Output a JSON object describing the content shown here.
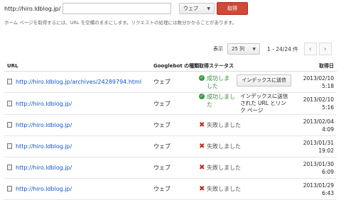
{
  "fetch": {
    "url_prefix": "http://hiro.ldblog.jp/",
    "url_value": "",
    "type_value": "ウェブ",
    "fetch_label": "取得",
    "help_text": "ホーム ページを取得するには、URL を空欄のままにします。リクエストの処理には数分かかることがあります。"
  },
  "pager": {
    "show_label": "表示",
    "per_page": "25 列",
    "range": "1 - 24/24 件"
  },
  "table": {
    "headers": {
      "url": "URL",
      "googlebot": "Googlebot の種類",
      "status": "取得ステータス",
      "date": "取得日"
    },
    "rows": [
      {
        "url": "http://hiro.ldblog.jp/archives/24289794.html",
        "type": "ウェブ",
        "status": "成功しました",
        "status_kind": "ok",
        "action": "インデックスに送信",
        "date": "2013/02/10",
        "time": "5:18"
      },
      {
        "url": "http://hiro.ldblog.jp/",
        "type": "ウェブ",
        "status": "成功しました",
        "status_kind": "ok",
        "action_text": "インデックスに送信された URL とリンク ページ",
        "date": "2013/02/10",
        "time": "5:16"
      },
      {
        "url": "http://hiro.ldblog.jp/",
        "type": "ウェブ",
        "status": "失敗しました",
        "status_kind": "fail",
        "date": "2013/02/04",
        "time": "4:09"
      },
      {
        "url": "http://hiro.ldblog.jp/",
        "type": "ウェブ",
        "status": "失敗しました",
        "status_kind": "fail",
        "date": "2013/01/31",
        "time": "19:02"
      },
      {
        "url": "http://hiro.ldblog.jp/",
        "type": "ウェブ",
        "status": "失敗しました",
        "status_kind": "fail",
        "date": "2013/01/30",
        "time": "6:09"
      },
      {
        "url": "http://hiro.ldblog.jp/",
        "type": "ウェブ",
        "status": "失敗しました",
        "status_kind": "fail",
        "date": "2013/01/29",
        "time": "6:43"
      }
    ]
  }
}
